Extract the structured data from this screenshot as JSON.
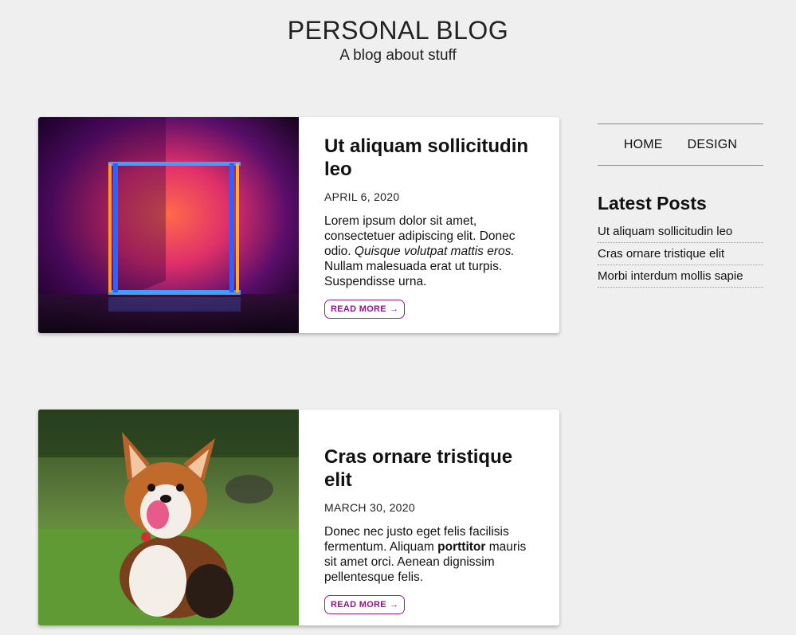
{
  "site": {
    "title": "PERSONAL BLOG",
    "tagline": "A blog about stuff"
  },
  "posts": [
    {
      "title": "Ut aliquam sollicitudin leo",
      "date": "APRIL 6, 2020",
      "excerpt_1": "Lorem ipsum dolor sit amet, consectetuer adipiscing elit. Donec odio. ",
      "excerpt_italic": "Quisque volutpat mattis eros.",
      "excerpt_2": " Nullam malesuada erat ut turpis. Suspendisse urna.",
      "read_more": "READ MORE",
      "image": "neon-light-room"
    },
    {
      "title": "Cras ornare tristique elit",
      "date": "MARCH 30, 2020",
      "excerpt_1": "Donec nec justo eget felis facilisis fermentum. Aliquam ",
      "excerpt_bold": "porttitor",
      "excerpt_2": " mauris sit amet orci. Aenean dignissim pellentesque felis.",
      "read_more": "READ MORE",
      "image": "corgi-on-grass"
    }
  ],
  "sidebar": {
    "nav": [
      "HOME",
      "DESIGN"
    ],
    "latest_heading": "Latest Posts",
    "latest_posts": [
      "Ut aliquam sollicitudin leo",
      "Cras ornare tristique elit",
      "Morbi interdum mollis sapie"
    ]
  },
  "colors": {
    "background": "#efefef",
    "accent": "#8e1783"
  },
  "icons": {
    "read_more_arrow": "arrow-right-icon"
  }
}
